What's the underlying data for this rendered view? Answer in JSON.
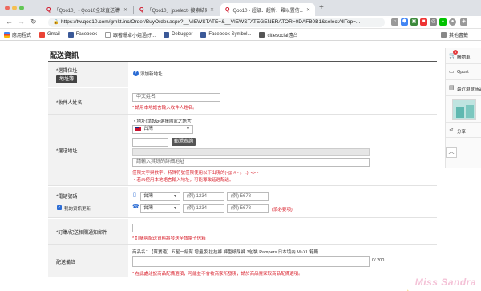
{
  "browser": {
    "tabs": [
      {
        "label": "「Qoo10」- Qoo10全球直送購物..."
      },
      {
        "label": "「Qoo10」jpselect- 搜索結果（..."
      },
      {
        "label": "Qoo10 - 超級．超新．難以置信..."
      }
    ],
    "url": "https://tw.qoo10.com/gmkt.inc/Order/BuyOrder.aspx?__VIEWSTATE=&__VIEWSTATEGENERATOR=0DAFB0B1&selectAllTop=..."
  },
  "bookmarks": {
    "items": [
      "應用程式",
      "Gmail",
      "Facebook",
      "跟著珊卓小姐過好...",
      "Debugger",
      "Facebook Symbol...",
      "citiesocial遠台"
    ],
    "other": "其他書籤"
  },
  "form": {
    "title": "配送資訊",
    "shipping_address": {
      "label": "*選擇位址",
      "book_button": "地址簿",
      "add_new": "添加新地址"
    },
    "recipient": {
      "label": "*收件人姓名",
      "placeholder": "中文姓名",
      "hint": "* 請用本地語言輸入收件人姓名。"
    },
    "address": {
      "label": "*選送地址",
      "country_hint": "・地址(請設定選擇國家之語言)",
      "country": "台灣",
      "postcode_button": "郵遞查詢",
      "detail_placeholder": "請輸入其餘的詳細地址",
      "hint1": "僅限文字與數字，特殊符號僅限使用以下出現的(-@ # - 。 .)| <> -",
      "hint2": "・若未使用本地語言輸入地址，可能導致延遲配送。"
    },
    "phone": {
      "label": "*電話號碼",
      "update_checkbox": "我的資訊更新",
      "country": "台灣",
      "ph1": "(例) 1234",
      "ph2": "(例) 5678",
      "required": "(須必要項)"
    },
    "email": {
      "label": "*訂購/配送相關通知郵件",
      "hint": "* 訂購與配送資料將發送至該電子信箱"
    },
    "memo": {
      "label": "配送備註",
      "product_label": "商品名：",
      "product": "【幫寶適】五星一級幫 增量版 拉拉褲 褲型紙尿褲 3包裝 Pampers 日本境內 M~XL 箱購",
      "count": "0/ 200",
      "hint": "* 在此處註記商品配備選項，可能並不會被商家所發現，請於商品賣家取商品配備選項。"
    }
  },
  "sidebar": {
    "cart": "購物車",
    "cart_count": "1",
    "qpost": "Qpost",
    "recent": "最近瀏覽商品",
    "share": "分享"
  },
  "watermark": "Miss Sandra"
}
